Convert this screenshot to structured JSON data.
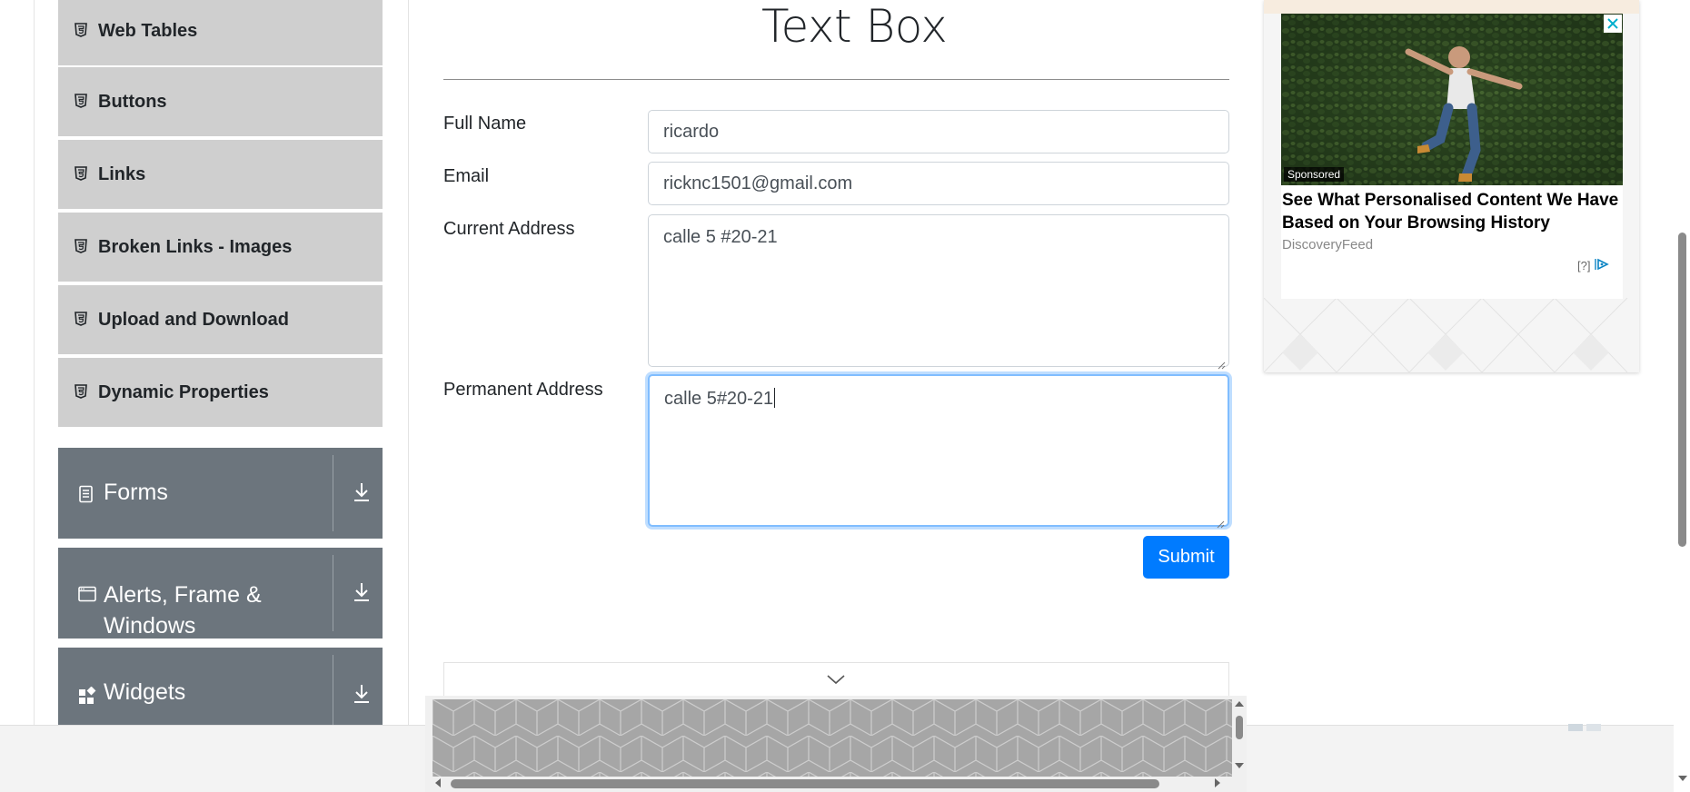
{
  "sidebar": {
    "items": [
      {
        "label": "Web Tables"
      },
      {
        "label": "Buttons"
      },
      {
        "label": "Links"
      },
      {
        "label": "Broken Links - Images"
      },
      {
        "label": "Upload and Download"
      },
      {
        "label": "Dynamic Properties"
      }
    ],
    "groups": [
      {
        "label": "Forms",
        "icon": "document-icon"
      },
      {
        "label_line1": "Alerts, Frame &",
        "label_line2": "Windows",
        "icon": "window-icon"
      },
      {
        "label": "Widgets",
        "icon": "widgets-icon"
      }
    ],
    "colors": {
      "item_bg": "#cfcfcf",
      "group_bg": "#6c757d"
    }
  },
  "main": {
    "title": "Text Box",
    "form": {
      "full_name_label": "Full Name",
      "full_name_value": "ricardo",
      "email_label": "Email",
      "email_value": "ricknc1501@gmail.com",
      "current_address_label": "Current Address",
      "current_address_value": "calle 5 #20-21",
      "permanent_address_label": "Permanent Address",
      "permanent_address_value": "calle 5#20-21",
      "submit_label": "Submit"
    },
    "colors": {
      "submit_bg": "#007bff",
      "focus_border": "#80bdff"
    }
  },
  "ad": {
    "sponsored_label": "Sponsored",
    "headline": "See What Personalised Content We Have Based on Your Browsing History",
    "source": "DiscoveryFeed",
    "info_label": "[?]"
  }
}
